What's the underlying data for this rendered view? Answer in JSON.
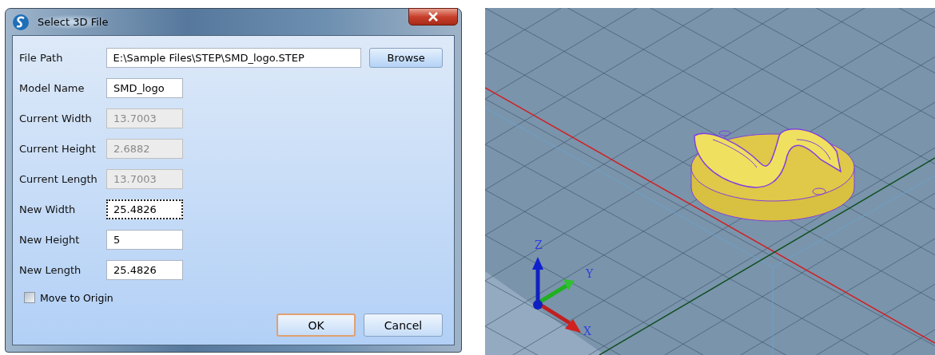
{
  "window": {
    "title": "Select 3D File"
  },
  "fields": [
    {
      "kind": "browse",
      "label": "File Path",
      "value": "E:\\Sample Files\\STEP\\SMD_logo.STEP",
      "disabled": false,
      "focused": false,
      "button": "Browse"
    },
    {
      "kind": "input",
      "label": "Model Name",
      "value": "SMD_logo",
      "disabled": false,
      "focused": false
    },
    {
      "kind": "input",
      "label": "Current Width",
      "value": "13.7003",
      "disabled": true,
      "focused": false
    },
    {
      "kind": "input",
      "label": "Current Height",
      "value": "2.6882",
      "disabled": true,
      "focused": false
    },
    {
      "kind": "input",
      "label": "Current Length",
      "value": "13.7003",
      "disabled": true,
      "focused": false
    },
    {
      "kind": "input",
      "label": "New Width",
      "value": "25.4826",
      "disabled": false,
      "focused": true
    },
    {
      "kind": "input",
      "label": "New Height",
      "value": "5",
      "disabled": false,
      "focused": false
    },
    {
      "kind": "input",
      "label": "New Length",
      "value": "25.4826",
      "disabled": false,
      "focused": false
    }
  ],
  "move_to_origin": {
    "label": "Move to Origin",
    "checked": false
  },
  "buttons": [
    {
      "label": "OK",
      "default": true
    },
    {
      "label": "Cancel",
      "default": false
    }
  ],
  "viewport": {
    "axis_labels": [
      "X",
      "Y",
      "Z"
    ]
  }
}
